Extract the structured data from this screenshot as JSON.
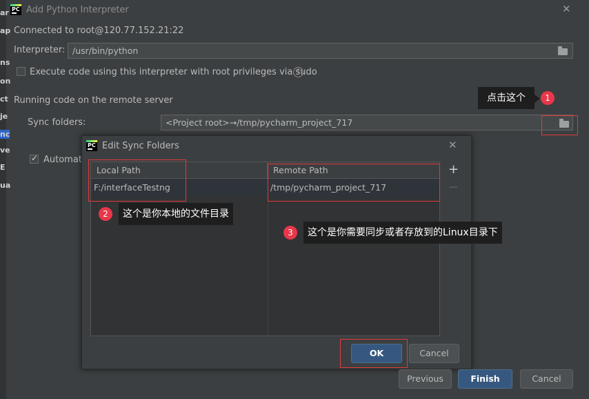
{
  "window": {
    "title": "Add Python Interpreter",
    "close_glyph": "✕",
    "connected": "Connected to root@120.77.152.21:22"
  },
  "left_edge_fragments": [
    "ar",
    "ap",
    "ns",
    "on",
    "ct",
    "je",
    "nc",
    "ve",
    "E",
    "ua"
  ],
  "interpreter": {
    "label": "Interpreter:",
    "value": "/usr/bin/python"
  },
  "sudo_option": {
    "label": "Execute code using this interpreter with root privileges via sudo",
    "checked": false,
    "help_glyph": "?"
  },
  "remote_section": {
    "heading": "Running code on the remote server",
    "sync_label": "Sync folders:",
    "sync_value": "<Project root>→/tmp/pycharm_project_717",
    "auto_label": "Automatic",
    "auto_checked": true
  },
  "annotations": {
    "a1_text": "点击这个",
    "a1_num": "1",
    "a2_text": "这个是你本地的文件目录",
    "a2_num": "2",
    "a3_text": "这个是你需要同步或者存放到的Linux目录下",
    "a3_num": "3",
    "badge_color": "#e8374a",
    "box_color": "#e23a3a"
  },
  "sync_dialog": {
    "title": "Edit Sync Folders",
    "close_glyph": "✕",
    "columns": [
      "Local Path",
      "Remote Path"
    ],
    "rows": [
      {
        "local": "F:/interfaceTestng",
        "remote": "/tmp/pycharm_project_717"
      }
    ],
    "add_glyph": "+",
    "remove_glyph": "−",
    "ok_label": "OK",
    "cancel_label": "Cancel"
  },
  "footer": {
    "previous_label": "Previous",
    "finish_label": "Finish",
    "cancel_label": "Cancel"
  },
  "colors": {
    "background": "#3c3f41",
    "primary_button": "#365880"
  }
}
